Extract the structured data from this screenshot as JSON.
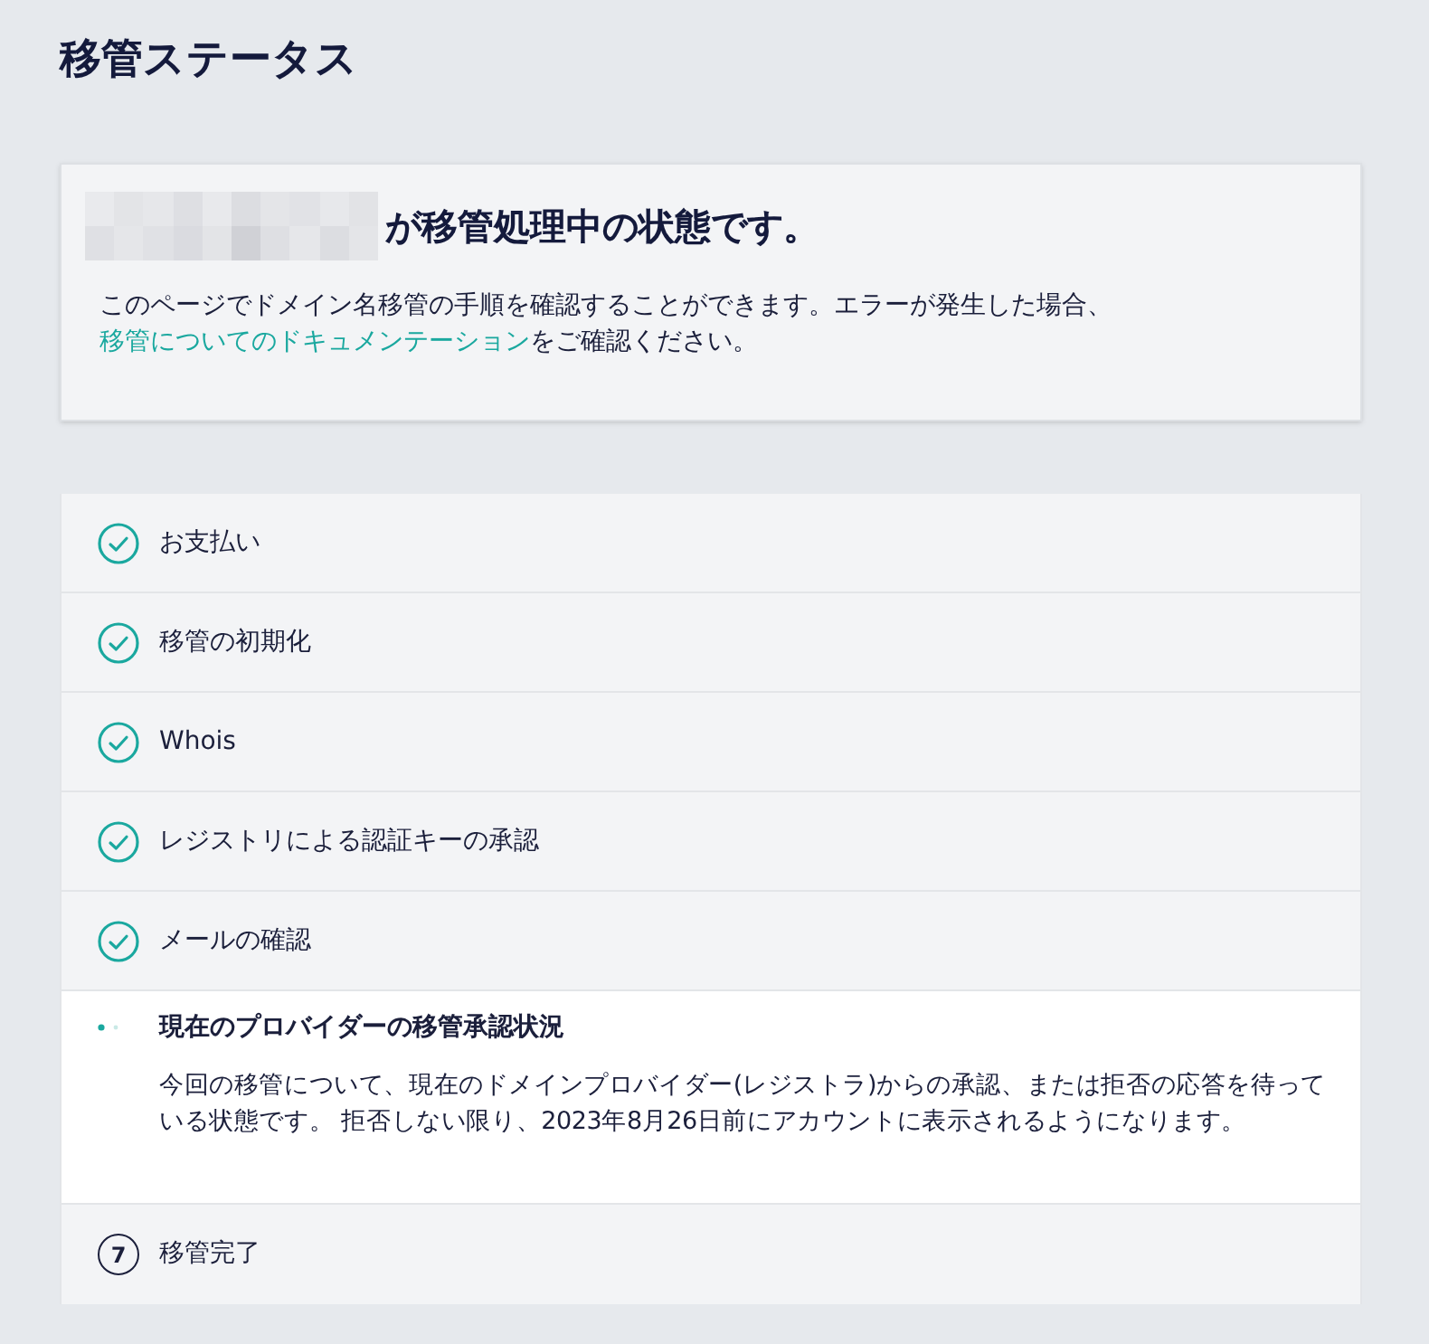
{
  "page_title": "移管ステータス",
  "status_card": {
    "heading": "が移管処理中の状態です。",
    "description": "このページでドメイン名移管の手順を確認することができます。エラーが発生した場合、 ",
    "link": "移管についてのドキュメンテーション",
    "description_end": "をご確認ください。"
  },
  "steps": [
    {
      "kind": "done",
      "label": "お支払い"
    },
    {
      "kind": "done",
      "label": "移管の初期化"
    },
    {
      "kind": "done",
      "label": "Whois"
    },
    {
      "kind": "done",
      "label": "レジストリによる認証キーの承認"
    },
    {
      "kind": "done",
      "label": "メールの確認"
    },
    {
      "kind": "active",
      "label": "現在のプロバイダーの移管承認状況",
      "description": "今回の移管について、現在のドメインプロバイダー(レジストラ)からの承認、または拒否の応答を待っている状態です。 拒否しない限り、2023年8月26日前にアカウントに表示されるようになります。"
    },
    {
      "kind": "pending",
      "number": "7",
      "label": "移管完了"
    }
  ]
}
